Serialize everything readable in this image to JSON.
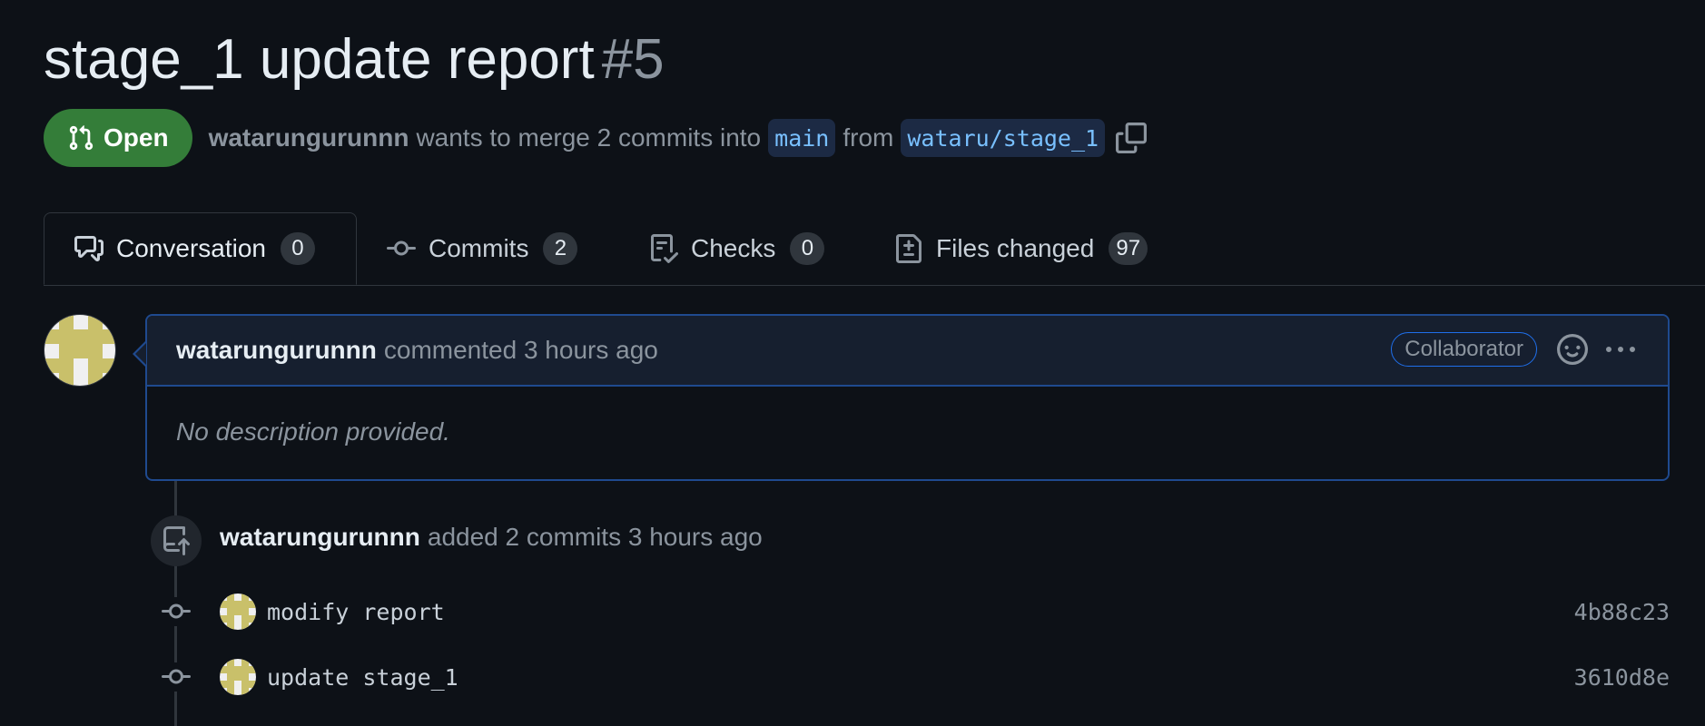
{
  "pr": {
    "title": "stage_1 update report",
    "number": "#5",
    "state": "Open",
    "author": "watarungurunnn",
    "merge_text": "wants to merge 2 commits into",
    "base_branch": "main",
    "from_text": "from",
    "head_branch": "wataru/stage_1"
  },
  "tabs": [
    {
      "label": "Conversation",
      "count": "0"
    },
    {
      "label": "Commits",
      "count": "2"
    },
    {
      "label": "Checks",
      "count": "0"
    },
    {
      "label": "Files changed",
      "count": "97"
    }
  ],
  "comment": {
    "author": "watarungurunnn",
    "action": "commented 3 hours ago",
    "role": "Collaborator",
    "body": "No description provided."
  },
  "timeline": {
    "push": {
      "author": "watarungurunnn",
      "action": "added 2 commits 3 hours ago"
    },
    "commits": [
      {
        "message": "modify report",
        "sha": "4b88c23"
      },
      {
        "message": "update stage_1",
        "sha": "3610d8e"
      }
    ]
  },
  "colors": {
    "open_green": "#347d39",
    "accent_blue": "#1f6feb",
    "branch_text": "#79c0ff",
    "avatar_tan": "#c9c06a"
  }
}
